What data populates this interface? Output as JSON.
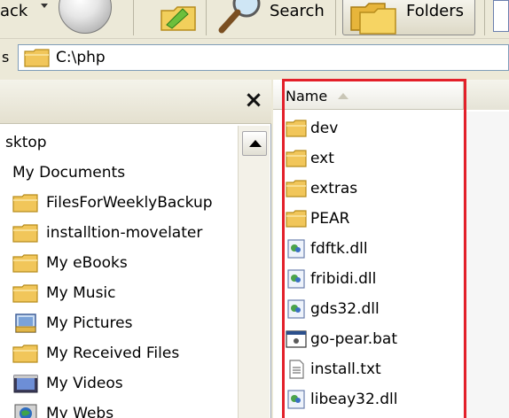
{
  "toolbar": {
    "back_label": "ack",
    "search_label": "Search",
    "folders_label": "Folders"
  },
  "address": {
    "label": "s",
    "path": "C:\\php"
  },
  "tree": {
    "close_glyph": "×",
    "items": [
      {
        "label": "sktop",
        "icon": "none"
      },
      {
        "label": "My Documents",
        "icon": "none"
      },
      {
        "label": "FilesForWeeklyBackup",
        "icon": "folder-icon"
      },
      {
        "label": "installtion-movelater",
        "icon": "folder-icon"
      },
      {
        "label": "My eBooks",
        "icon": "folder-icon"
      },
      {
        "label": "My Music",
        "icon": "folder-icon"
      },
      {
        "label": "My Pictures",
        "icon": "pictures-folder-icon"
      },
      {
        "label": "My Received Files",
        "icon": "folder-icon"
      },
      {
        "label": "My Videos",
        "icon": "videos-folder-icon"
      },
      {
        "label": "My Webs",
        "icon": "webs-folder-icon"
      }
    ]
  },
  "files": {
    "column_name": "Name",
    "items": [
      {
        "name": "dev",
        "icon": "folder-icon"
      },
      {
        "name": "ext",
        "icon": "folder-icon"
      },
      {
        "name": "extras",
        "icon": "folder-icon"
      },
      {
        "name": "PEAR",
        "icon": "folder-icon"
      },
      {
        "name": "fdftk.dll",
        "icon": "dll-icon"
      },
      {
        "name": "fribidi.dll",
        "icon": "dll-icon"
      },
      {
        "name": "gds32.dll",
        "icon": "dll-icon"
      },
      {
        "name": "go-pear.bat",
        "icon": "bat-icon"
      },
      {
        "name": "install.txt",
        "icon": "txt-icon"
      },
      {
        "name": "libeay32.dll",
        "icon": "dll-icon"
      }
    ]
  },
  "colors": {
    "highlight": "#e3202a",
    "folder": "#f1c65a"
  }
}
